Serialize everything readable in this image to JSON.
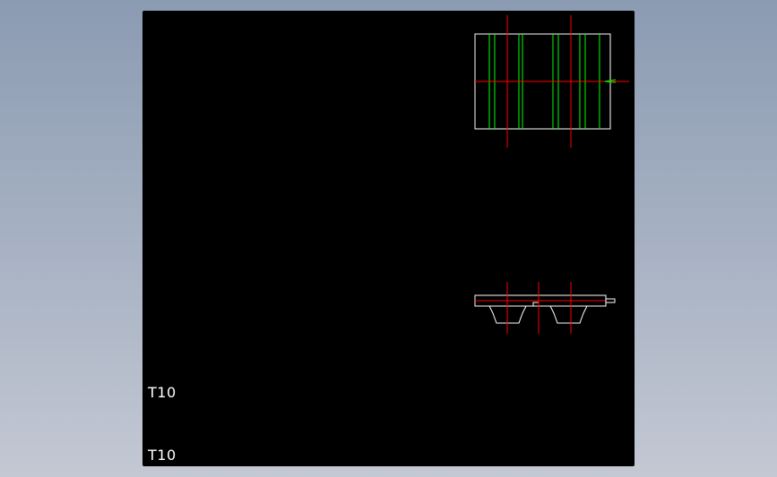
{
  "viewport": {
    "labels": [
      "T10",
      "T10"
    ]
  },
  "colors": {
    "background_top": "#8b9bb2",
    "background_bottom": "#c3c8d3",
    "viewport": "#000000",
    "outline": "#ffffff",
    "centerline": "#ff0000",
    "tooth_line": "#00ff00"
  },
  "views": {
    "top_view": "belt-plan-view",
    "front_view": "belt-tooth-profile-view"
  }
}
